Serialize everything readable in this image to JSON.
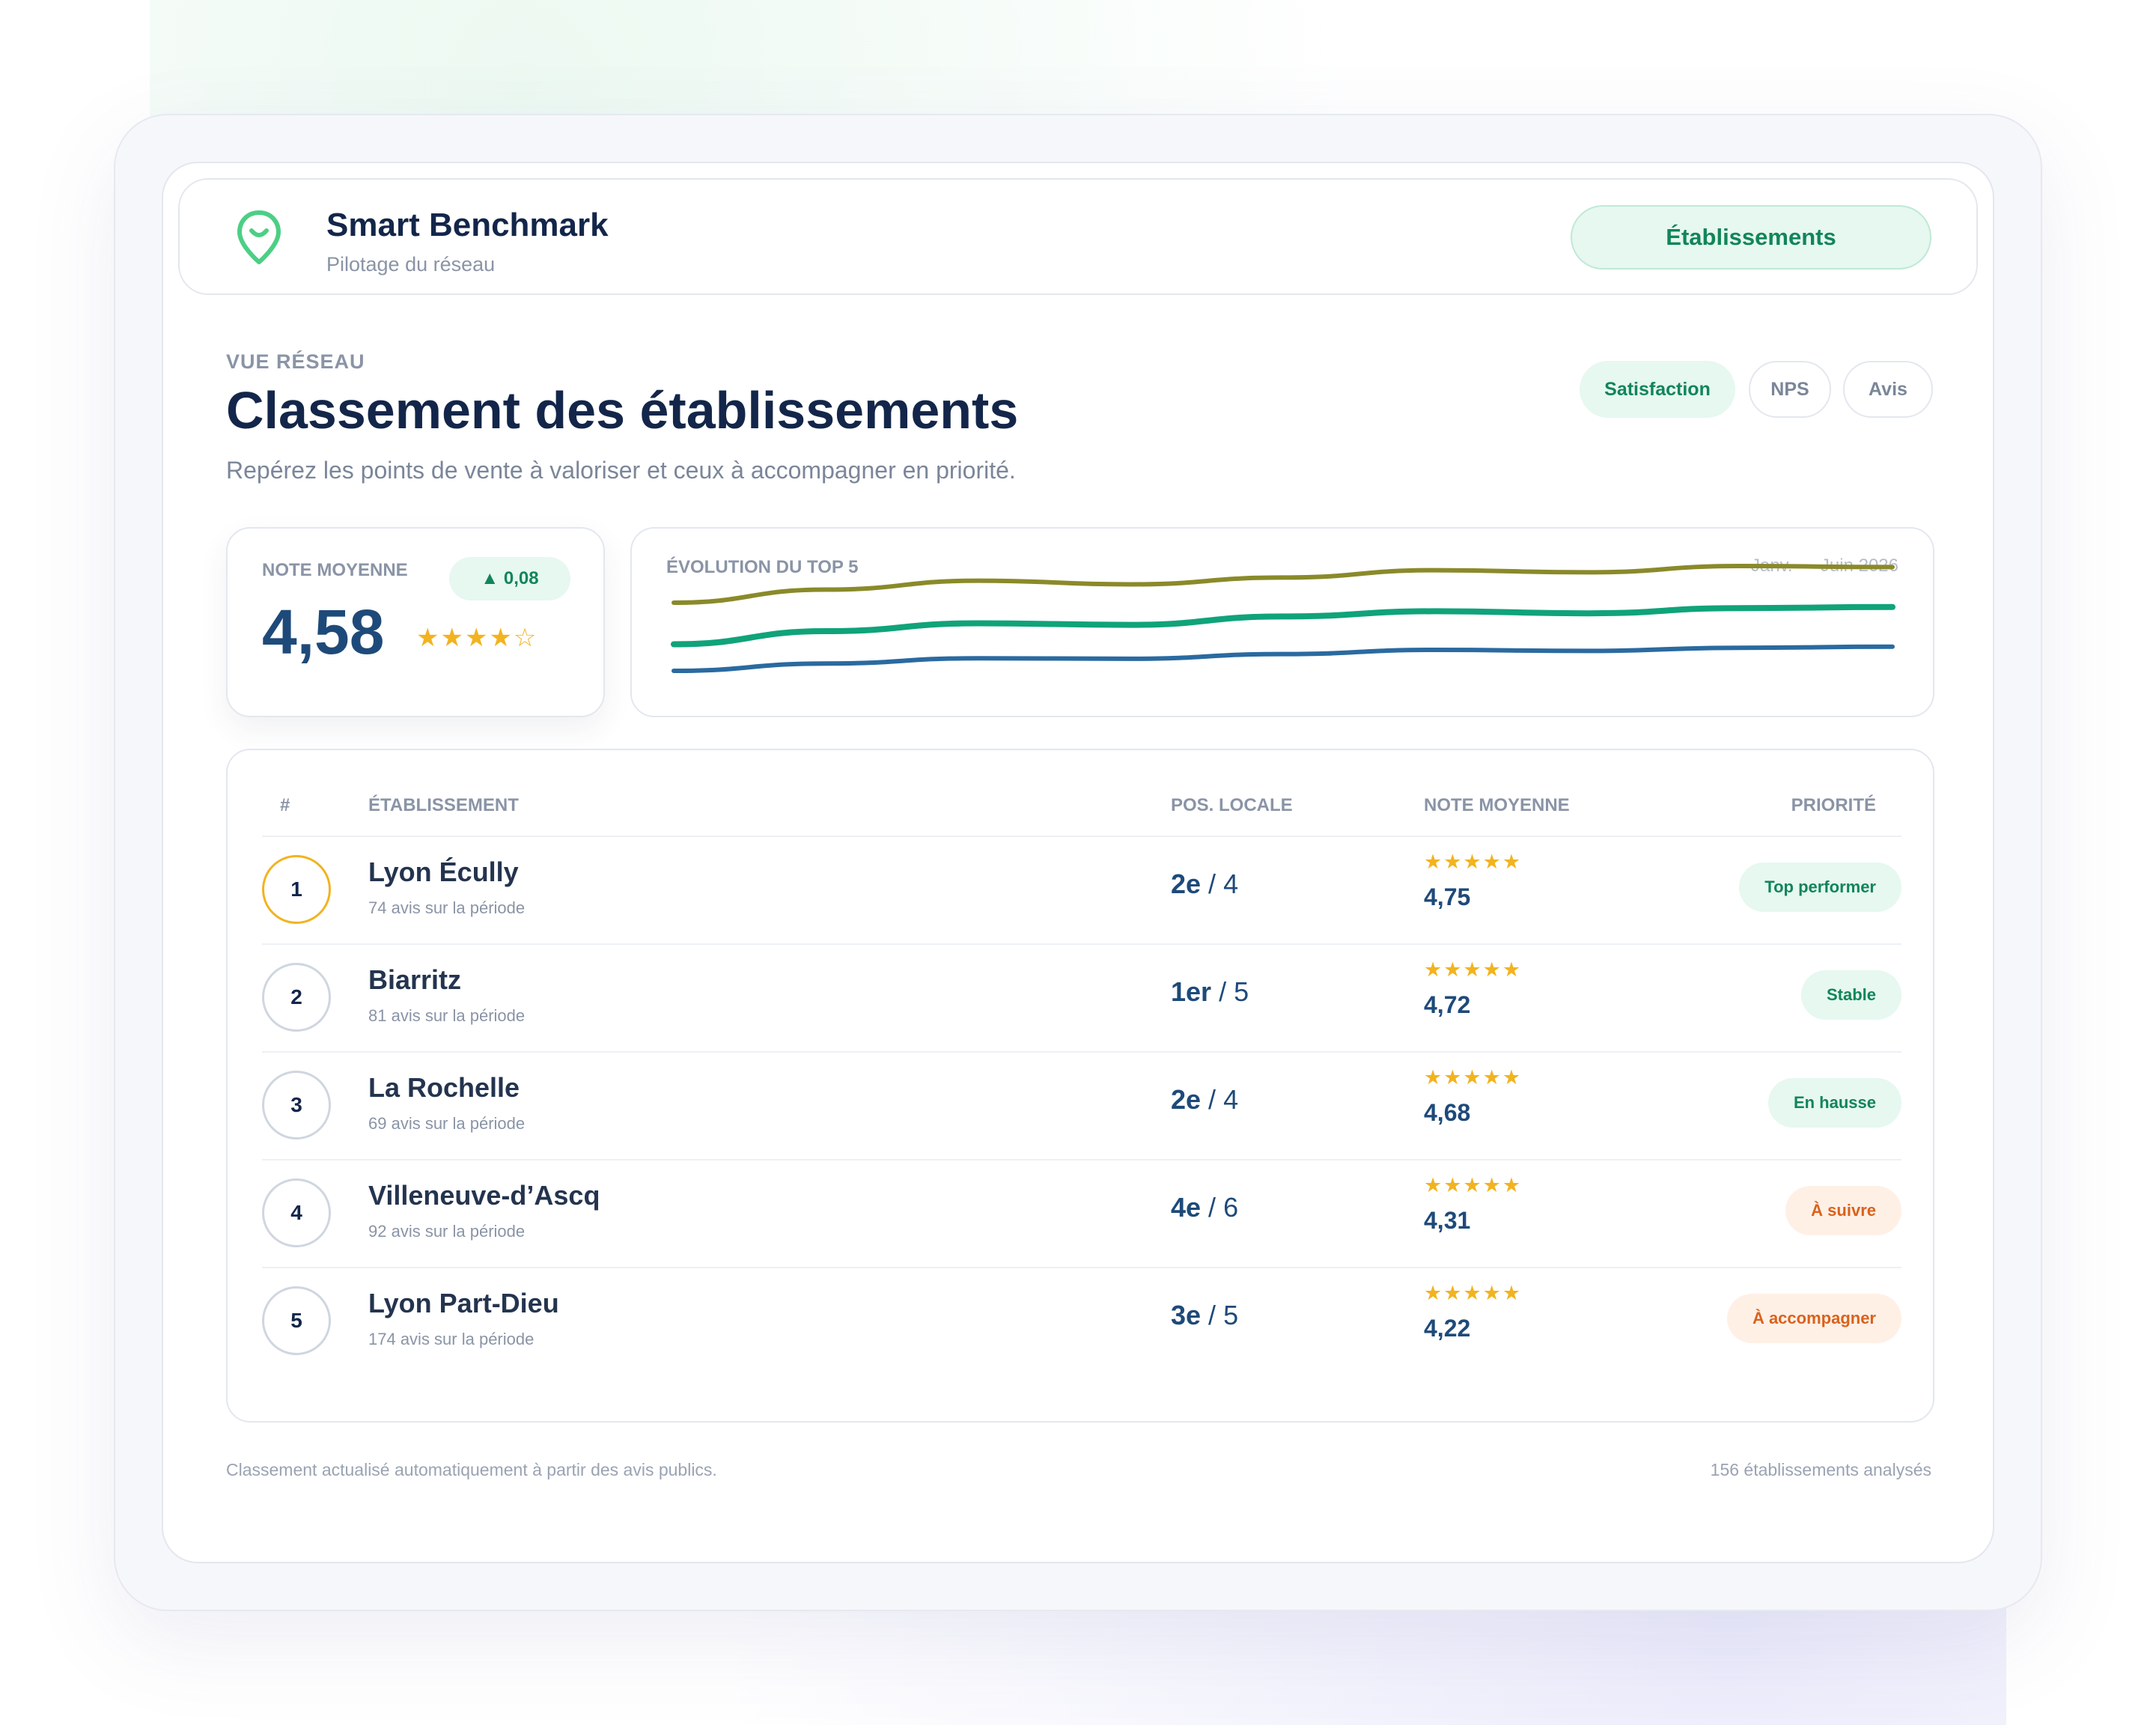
{
  "header": {
    "brand_title": "Smart Benchmark",
    "brand_subtitle": "Pilotage du réseau",
    "nav_button": "Établissements"
  },
  "page": {
    "eyebrow": "VUE RÉSEAU",
    "title": "Classement des établissements",
    "subtitle": "Repérez les points de vente à valoriser et ceux à accompagner en priorité."
  },
  "segments": {
    "satisfaction": "Satisfaction",
    "nps": "NPS",
    "avis": "Avis",
    "active": "Satisfaction"
  },
  "kpi": {
    "label": "NOTE MOYENNE",
    "delta": "▲ 0,08",
    "value": "4,58",
    "stars": "★★★★☆"
  },
  "trend": {
    "label": "ÉVOLUTION DU TOP 5",
    "period": "Janv. — Juin 2026"
  },
  "chart_data": {
    "type": "line",
    "series": [
      {
        "color": "#8a8a2a",
        "values": [
          0.3,
          0.55,
          0.72,
          0.65,
          0.78,
          0.92,
          0.88,
          1.0,
          0.98
        ]
      },
      {
        "color": "#10a37a",
        "values": [
          0.15,
          0.4,
          0.55,
          0.52,
          0.68,
          0.78,
          0.74,
          0.84,
          0.86
        ]
      },
      {
        "color": "#2a6aa0",
        "values": [
          0.0,
          0.14,
          0.24,
          0.23,
          0.32,
          0.4,
          0.38,
          0.44,
          0.46
        ]
      }
    ],
    "colors": [
      "#8a8a2a",
      "#10a37a",
      "#2a6aa0"
    ]
  },
  "table": {
    "headers": {
      "rank": "#",
      "name": "ÉTABLISSEMENT",
      "pos": "POS. LOCALE",
      "note": "NOTE MOYENNE",
      "priority": "PRIORITÉ"
    },
    "rows": [
      {
        "rank": "1",
        "name": "Lyon Écully",
        "sub": "74 avis sur la période",
        "pos_main": "2e",
        "pos_sep": " / ",
        "pos_total": "4",
        "stars": "★★★★★",
        "score": "4,75",
        "badge": "Top performer"
      },
      {
        "rank": "2",
        "name": "Biarritz",
        "sub": "81 avis sur la période",
        "pos_main": "1er",
        "pos_sep": " / ",
        "pos_total": "5",
        "stars": "★★★★★",
        "score": "4,72",
        "badge": "Stable"
      },
      {
        "rank": "3",
        "name": "La Rochelle",
        "sub": "69 avis sur la période",
        "pos_main": "2e",
        "pos_sep": " / ",
        "pos_total": "4",
        "stars": "★★★★★",
        "score": "4,68",
        "badge": "En hausse"
      },
      {
        "rank": "4",
        "name": "Villeneuve-d’Ascq",
        "sub": "92 avis sur la période",
        "pos_main": "4e",
        "pos_sep": " / ",
        "pos_total": "6",
        "stars": "★★★★★",
        "score": "4,31",
        "badge": "À suivre"
      },
      {
        "rank": "5",
        "name": "Lyon Part-Dieu",
        "sub": "174 avis sur la période",
        "pos_main": "3e",
        "pos_sep": " / ",
        "pos_total": "5",
        "stars": "★★★★★",
        "score": "4,22",
        "badge": "À accompagner"
      }
    ]
  },
  "footer": {
    "left": "Classement actualisé automatiquement à partir des avis publics.",
    "right": "156 établissements analysés"
  }
}
